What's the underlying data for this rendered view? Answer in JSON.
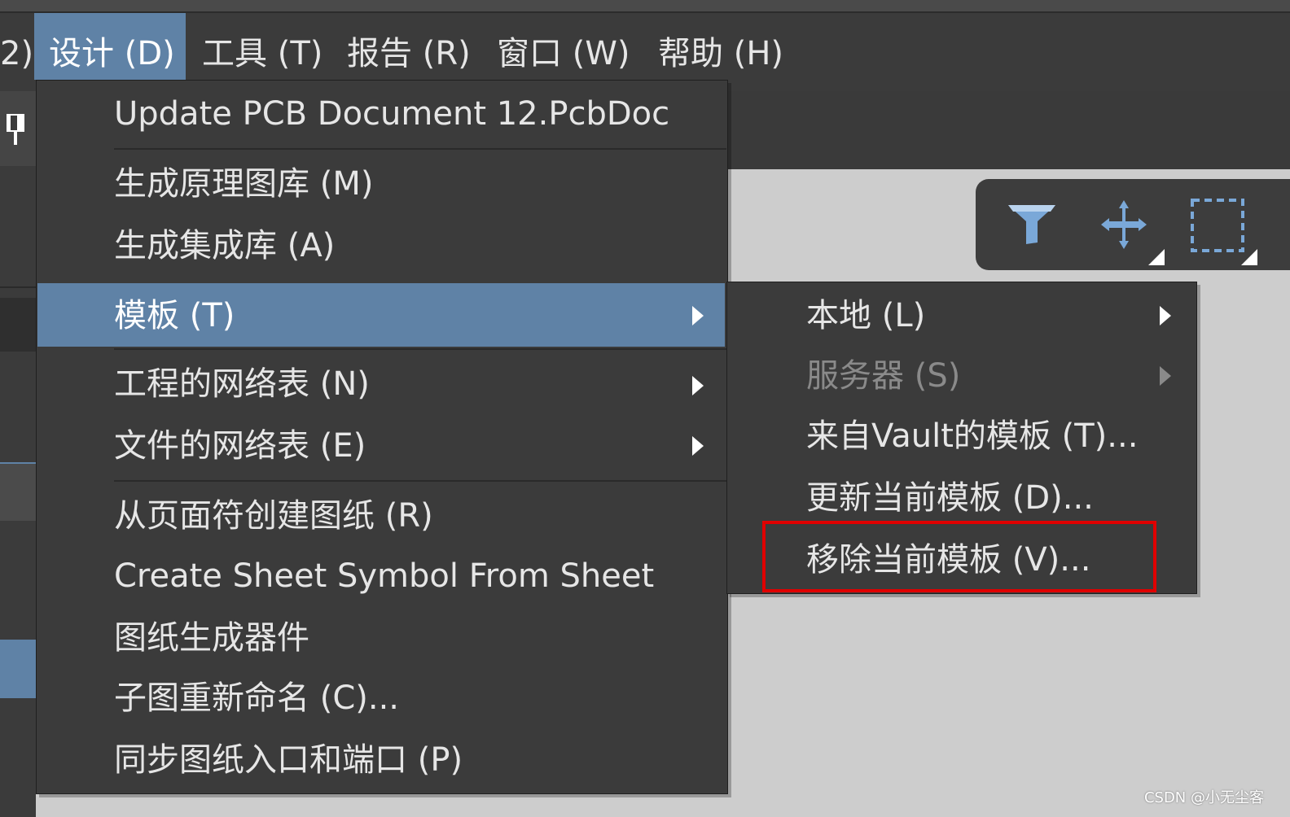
{
  "menubar": {
    "items": [
      {
        "label": "2)"
      },
      {
        "label": "设计 (D)",
        "active": true
      },
      {
        "label": "工具 (T)"
      },
      {
        "label": "报告 (R)"
      },
      {
        "label": "窗口 (W)"
      },
      {
        "label": "帮助 (H)"
      }
    ]
  },
  "design_menu": {
    "items": [
      {
        "label": "Update PCB Document 12.PcbDoc"
      },
      {
        "label": "生成原理图库 (M)"
      },
      {
        "label": "生成集成库 (A)"
      },
      {
        "label": "模板 (T)",
        "highlighted": true,
        "submenu": true
      },
      {
        "label": "工程的网络表 (N)",
        "submenu": true
      },
      {
        "label": "文件的网络表 (E)",
        "submenu": true
      },
      {
        "label": "从页面符创建图纸 (R)"
      },
      {
        "label": "Create Sheet Symbol From Sheet"
      },
      {
        "label": "图纸生成器件"
      },
      {
        "label": "子图重新命名 (C)..."
      },
      {
        "label": "同步图纸入口和端口 (P)"
      }
    ]
  },
  "template_menu": {
    "items": [
      {
        "label": "本地 (L)",
        "submenu": true
      },
      {
        "label": "服务器 (S)",
        "submenu": true,
        "disabled": true
      },
      {
        "label": "来自Vault的模板 (T)..."
      },
      {
        "label": "更新当前模板 (D)..."
      },
      {
        "label": "移除当前模板 (V)...",
        "boxed": true
      }
    ]
  },
  "floating_toolbar": {
    "icons": [
      "filter-icon",
      "move-icon",
      "select-rectangle-icon"
    ]
  },
  "watermark": {
    "text": "CSDN @小无尘客"
  },
  "colors": {
    "menu_bg": "#3b3b3b",
    "highlight": "#5f82a6",
    "callout": "#e00000",
    "icon_blue": "#7aa8d8"
  }
}
